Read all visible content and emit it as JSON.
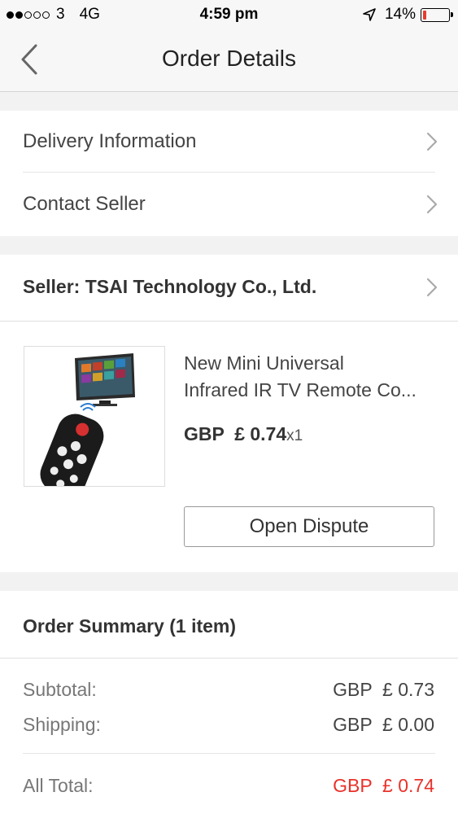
{
  "status_bar": {
    "carrier": "3",
    "network": "4G",
    "time": "4:59 pm",
    "battery": "14%",
    "battery_level": 0.14
  },
  "nav": {
    "title": "Order Details"
  },
  "menu": {
    "delivery": "Delivery Information",
    "contact": "Contact Seller"
  },
  "seller": {
    "label": "Seller: TSAI Technology Co., Ltd."
  },
  "product": {
    "title_line1": "New Mini Universal",
    "title_line2": "Infrared IR TV Remote Co...",
    "price": "GBP  £ 0.74",
    "quantity": "x1",
    "dispute_button": "Open Dispute"
  },
  "summary": {
    "header": "Order Summary (1 item)",
    "subtotal_label": "Subtotal:",
    "subtotal_value": "GBP  £ 0.73",
    "shipping_label": "Shipping:",
    "shipping_value": "GBP  £ 0.00",
    "total_label": "All Total:",
    "total_value": "GBP  £ 0.74"
  },
  "colors": {
    "accent_red": "#e8322a",
    "background": "#f2f2f2"
  }
}
